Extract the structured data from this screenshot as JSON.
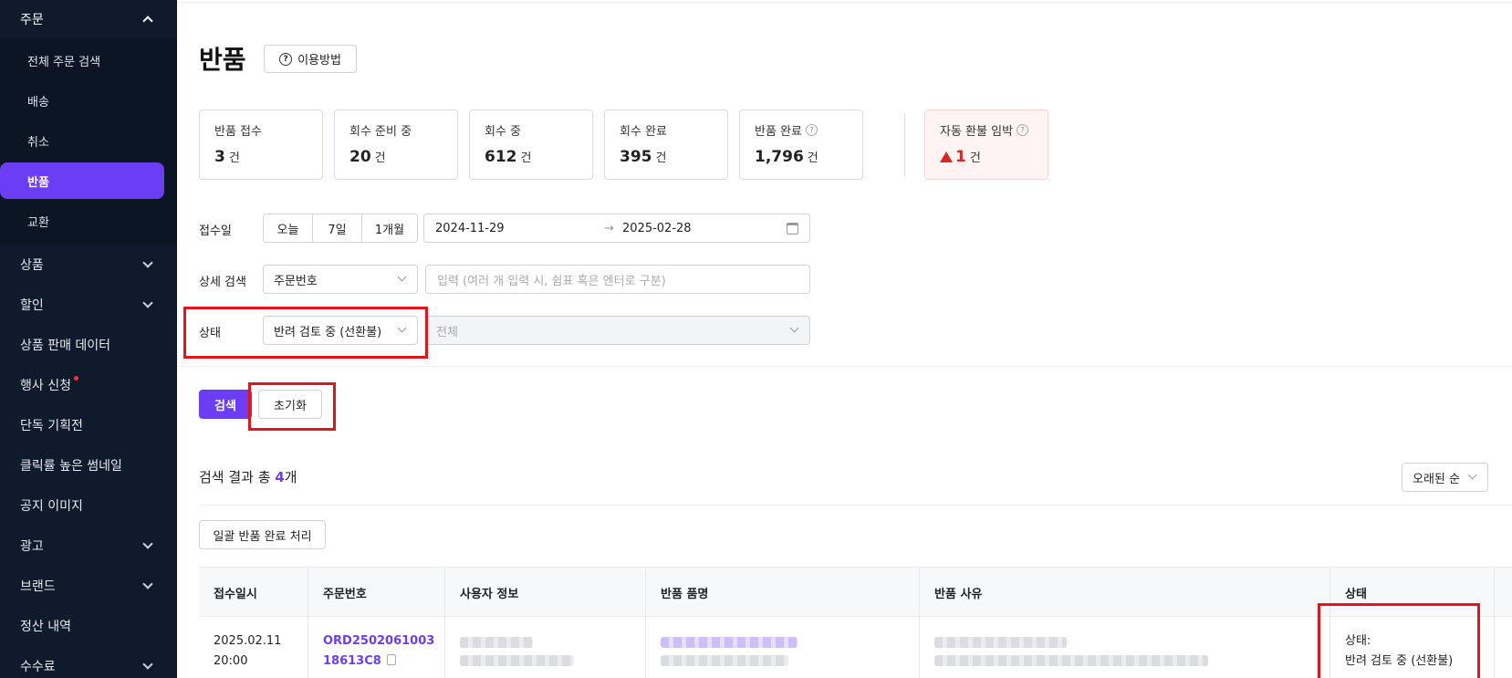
{
  "sidebar": {
    "group": "주문",
    "sub_items": [
      "전체 주문 검색",
      "배송",
      "취소",
      "반품",
      "교환"
    ],
    "active": "반품",
    "items": [
      {
        "label": "상품",
        "chevron": true
      },
      {
        "label": "할인",
        "chevron": true
      },
      {
        "label": "상품 판매 데이터",
        "chevron": false
      },
      {
        "label": "행사 신청",
        "chevron": false,
        "dot": true
      },
      {
        "label": "단독 기획전",
        "chevron": false
      },
      {
        "label": "클릭률 높은 썸네일",
        "chevron": false
      },
      {
        "label": "공지 이미지",
        "chevron": false
      },
      {
        "label": "광고",
        "chevron": true
      },
      {
        "label": "브랜드",
        "chevron": true
      },
      {
        "label": "정산 내역",
        "chevron": false
      },
      {
        "label": "수수료",
        "chevron": true
      }
    ]
  },
  "header": {
    "title": "반품",
    "help_label": "이용방법"
  },
  "stats": [
    {
      "label": "반품 접수",
      "value": "3",
      "unit": "건"
    },
    {
      "label": "회수 준비 중",
      "value": "20",
      "unit": "건"
    },
    {
      "label": "회수 중",
      "value": "612",
      "unit": "건"
    },
    {
      "label": "회수 완료",
      "value": "395",
      "unit": "건"
    },
    {
      "label": "반품 완료",
      "value": "1,796",
      "unit": "건",
      "help": true
    }
  ],
  "warn_stat": {
    "label": "자동 환불 임박",
    "value": "1",
    "unit": "건"
  },
  "filters": {
    "date_label": "접수일",
    "ranges": [
      "오늘",
      "7일",
      "1개월"
    ],
    "date_from": "2024-11-29",
    "date_arrow": "→",
    "date_to": "2025-02-28",
    "detail_label": "상세 검색",
    "detail_select": "주문번호",
    "detail_placeholder": "입력 (여러 개 입력 시, 쉼표 혹은 엔터로 구분)",
    "status_label": "상태",
    "status_select": "반려 검토 중 (선환불)",
    "status_sub_select": "전체"
  },
  "actions": {
    "search": "검색",
    "reset": "초기화",
    "bulk": "일괄 반품 완료 처리"
  },
  "results": {
    "prefix": "검색 결과 총 ",
    "count": "4",
    "suffix": "개",
    "sort": "오래된 순"
  },
  "table": {
    "columns": [
      "접수일시",
      "주문번호",
      "사용자 정보",
      "반품 품명",
      "반품 사유",
      "상태"
    ],
    "rows": [
      {
        "date": "2025.02.11",
        "time": "20:00",
        "order_1": "ORD2502061003",
        "order_2": "18613C8",
        "status_label": "상태:",
        "status_value": "반려 검토 중 (선환불)"
      }
    ]
  }
}
